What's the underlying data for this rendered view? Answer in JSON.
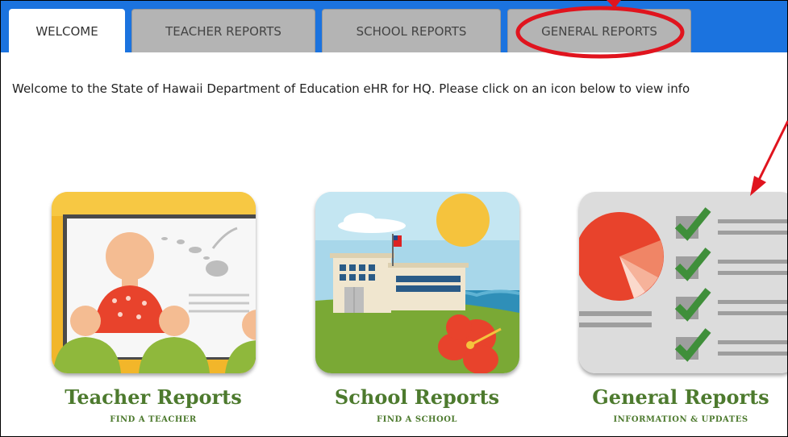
{
  "tabs": [
    {
      "label": "WELCOME",
      "active": true
    },
    {
      "label": "TEACHER REPORTS",
      "active": false
    },
    {
      "label": "SCHOOL REPORTS",
      "active": false
    },
    {
      "label": "GENERAL REPORTS",
      "active": false
    }
  ],
  "welcome_message": "Welcome to the State of Hawaii Department of Education eHR for HQ. Please click on an icon below to view info",
  "tiles": [
    {
      "title": "Teacher Reports",
      "subtitle": "FIND A TEACHER",
      "icon": "teacher-reports-icon"
    },
    {
      "title": "School Reports",
      "subtitle": "FIND A SCHOOL",
      "icon": "school-reports-icon"
    },
    {
      "title": "General Reports",
      "subtitle": "INFORMATION & UPDATES",
      "icon": "general-reports-icon"
    }
  ],
  "annotations": {
    "highlight_color": "#e0141e",
    "highlighted_tab": "GENERAL REPORTS"
  },
  "colors": {
    "tab_bar": "#1b73df",
    "tab_inactive": "#b4b4b4",
    "title_green": "#4d7a2e"
  }
}
